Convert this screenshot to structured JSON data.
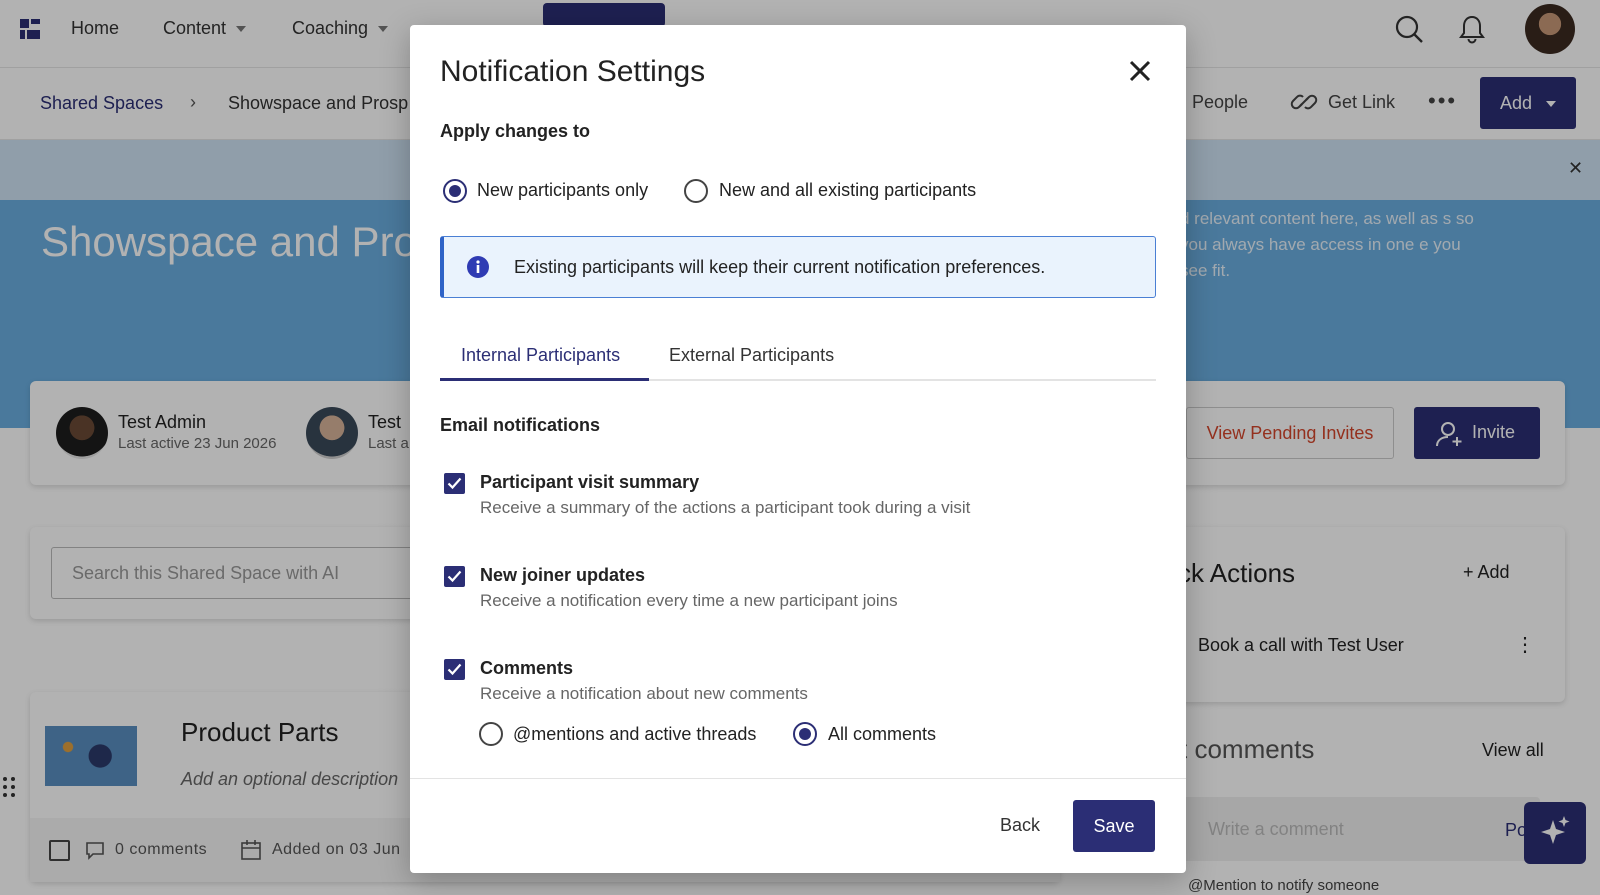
{
  "topnav": {
    "items": [
      {
        "label": "Home"
      },
      {
        "label": "Content"
      },
      {
        "label": "Coaching"
      }
    ],
    "icons": [
      "search-icon",
      "bell-icon"
    ]
  },
  "subbar": {
    "breadcrumb_link": "Shared Spaces",
    "breadcrumb_current": "Showspace and Prosp",
    "people": "People",
    "get_link": "Get Link",
    "more": "•••",
    "add": "Add"
  },
  "hero": {
    "title": "Showspace and Pros",
    "description": "d relevant content here, as well as s so you always have access in one e you see fit."
  },
  "members": [
    {
      "name": "Test Admin",
      "sub": "Last active 23 Jun 2026"
    },
    {
      "name": "Test",
      "sub": "Last a"
    }
  ],
  "members_actions": {
    "pending": "View Pending Invites",
    "invite": "Invite"
  },
  "search": {
    "placeholder": "Search this Shared Space with AI"
  },
  "quick_actions": {
    "title": "ck Actions",
    "add": "+ Add",
    "item": "Book a call with Test User"
  },
  "comments": {
    "title": "t comments",
    "view_all": "View all",
    "placeholder": "Write a comment",
    "post": "Po",
    "hint": "@Mention to notify someone"
  },
  "product": {
    "title": "Product Parts",
    "description": "Add an optional description",
    "comments": "0 comments",
    "added": "Added on 03 Jun"
  },
  "modal": {
    "title": "Notification Settings",
    "apply_label": "Apply changes to",
    "apply_options": [
      {
        "label": "New participants only",
        "selected": true
      },
      {
        "label": "New and all existing participants",
        "selected": false
      }
    ],
    "info": "Existing participants will keep their current notification preferences.",
    "tabs": [
      {
        "label": "Internal Participants",
        "active": true
      },
      {
        "label": "External Participants",
        "active": false
      }
    ],
    "email_heading": "Email notifications",
    "options": [
      {
        "title": "Participant visit summary",
        "desc": "Receive a summary of the actions a participant took during a visit",
        "checked": true
      },
      {
        "title": "New joiner updates",
        "desc": "Receive a notification every time a new participant joins",
        "checked": true
      },
      {
        "title": "Comments",
        "desc": "Receive a notification about new comments",
        "checked": true
      }
    ],
    "comment_scope": [
      {
        "label": "@mentions and active threads",
        "selected": false
      },
      {
        "label": "All comments",
        "selected": true
      }
    ],
    "back": "Back",
    "save": "Save"
  },
  "colors": {
    "primary": "#2b2e75",
    "hero": "#6aaee0",
    "info_bg": "#eaf3fd",
    "info_border": "#2f63c7",
    "danger_text": "#d4462b"
  }
}
